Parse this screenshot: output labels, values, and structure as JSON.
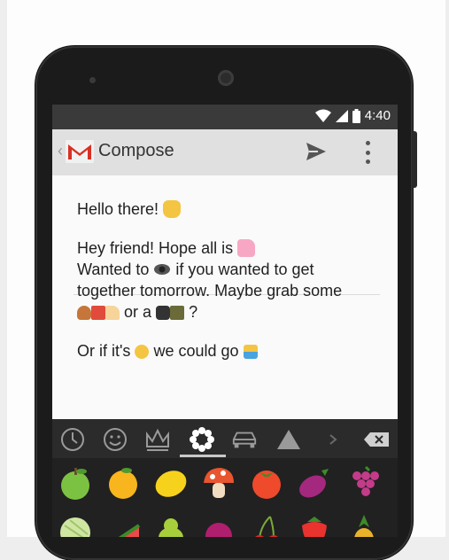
{
  "status_bar": {
    "time": "4:40",
    "icons": [
      "wifi-icon",
      "signal-icon",
      "battery-icon"
    ]
  },
  "app_bar": {
    "title": "Compose",
    "icons": [
      "back-arrow-icon",
      "gmail-logo-icon",
      "send-icon",
      "overflow-menu-icon"
    ]
  },
  "message": {
    "subject": "Hello there!",
    "body_lines": [
      "Hey friend! Hope all is",
      "Wanted to",
      "if you wanted to get",
      "together tomorrow. Maybe grab some",
      "or a",
      "?",
      "Or if it's",
      "we could go"
    ]
  },
  "emoji_keyboard": {
    "tabs": [
      "recent-clock-icon",
      "smiley-icon",
      "crown-icon",
      "flower-icon",
      "car-icon",
      "triangle-icon",
      "more-right-icon",
      "backspace-icon"
    ],
    "active_tab": "flower-icon",
    "emoji_row1": [
      "green-apple-icon",
      "orange-icon",
      "lemon-icon",
      "mushroom-icon",
      "tomato-icon",
      "eggplant-icon",
      "grapes-icon"
    ],
    "emoji_row2": [
      "melon-icon",
      "watermelon-icon",
      "pear-icon",
      "plum-icon",
      "cherries-icon",
      "strawberry-icon",
      "pineapple-icon"
    ]
  },
  "colors": {
    "status_bar": "#3a3a3a",
    "app_bar": "#e0e0e0",
    "keyboard_bg": "#212121",
    "gmail_red": "#d93025"
  }
}
